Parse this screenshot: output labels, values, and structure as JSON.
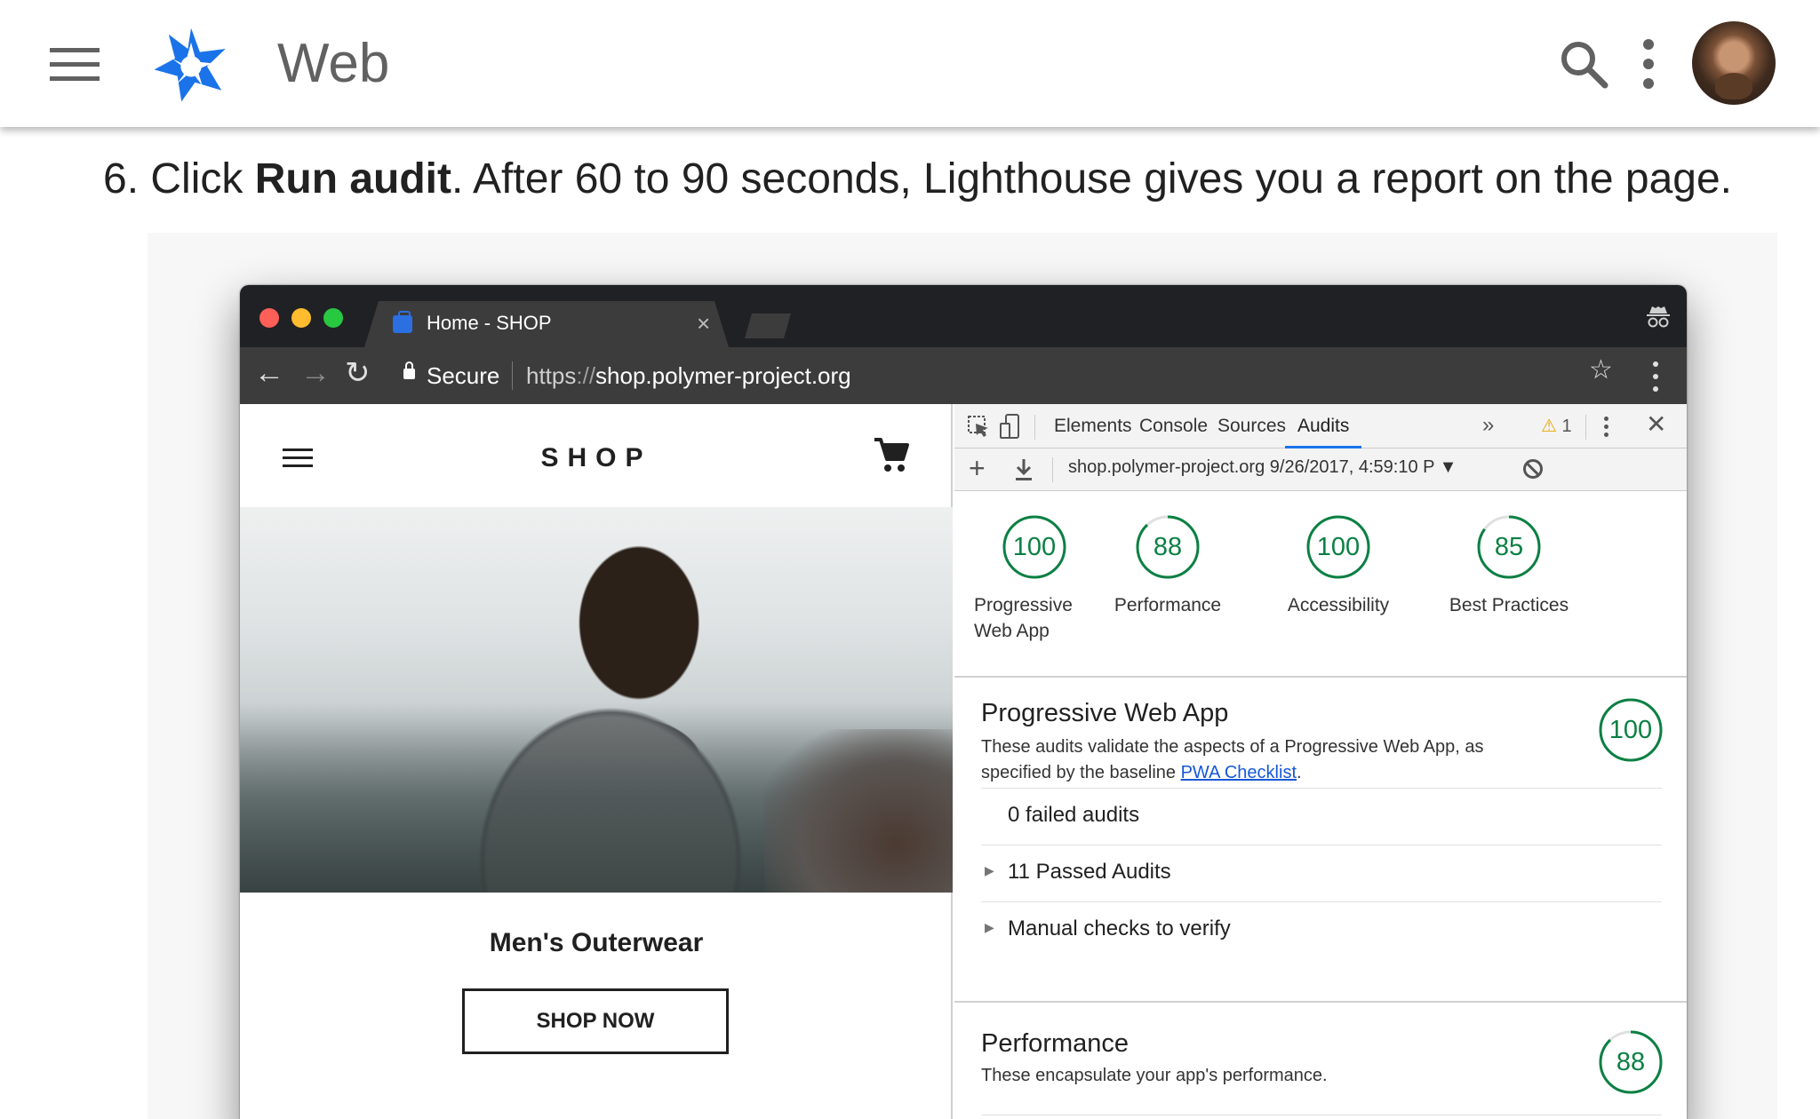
{
  "site": {
    "title": "Web",
    "icons": {
      "menu": "menu-icon",
      "logo": "web-fundamentals-logo",
      "search": "search-icon",
      "more": "more-vert-icon",
      "avatar": "user-avatar"
    }
  },
  "step": {
    "prefix": "6. Click ",
    "bold": "Run audit",
    "suffix": ". After 60 to 90 seconds, Lighthouse gives you a report on the page."
  },
  "browser": {
    "tab_title": "Home - SHOP",
    "tab_close": "×",
    "secure_label": "Secure",
    "url_scheme": "https",
    "url_sep": "://",
    "url_host": "shop.polymer-project.org",
    "nav": {
      "back": "←",
      "forward": "→",
      "reload": "↻"
    },
    "star": "☆"
  },
  "shop": {
    "title": "SHOP",
    "category": "Men's Outerwear",
    "cta": "SHOP NOW"
  },
  "devtools": {
    "tabs": [
      "Elements",
      "Console",
      "Sources",
      "Audits"
    ],
    "active_tab": "Audits",
    "more_tabs": "»",
    "warning_count": "1",
    "close": "✕",
    "report_select": "shop.polymer-project.org 9/26/2017, 4:59:10 P ▼",
    "add": "+",
    "scores": [
      {
        "label": "Progressive Web App",
        "value": 100
      },
      {
        "label": "Performance",
        "value": 88
      },
      {
        "label": "Accessibility",
        "value": 100
      },
      {
        "label": "Best Practices",
        "value": 85
      }
    ],
    "pwa_section": {
      "title": "Progressive Web App",
      "desc_prefix": "These audits validate the aspects of a Progressive Web App, as specified by the baseline ",
      "link": "PWA Checklist",
      "desc_suffix": ".",
      "score": 100,
      "rows": [
        "0 failed audits",
        "11 Passed Audits",
        "Manual checks to verify"
      ]
    },
    "perf_section": {
      "title": "Performance",
      "desc": "These encapsulate your app's performance.",
      "score": 88
    },
    "colors": {
      "pass": "#0b8043",
      "track": "#e0e0e0",
      "active_tab": "#1a73e8"
    }
  }
}
